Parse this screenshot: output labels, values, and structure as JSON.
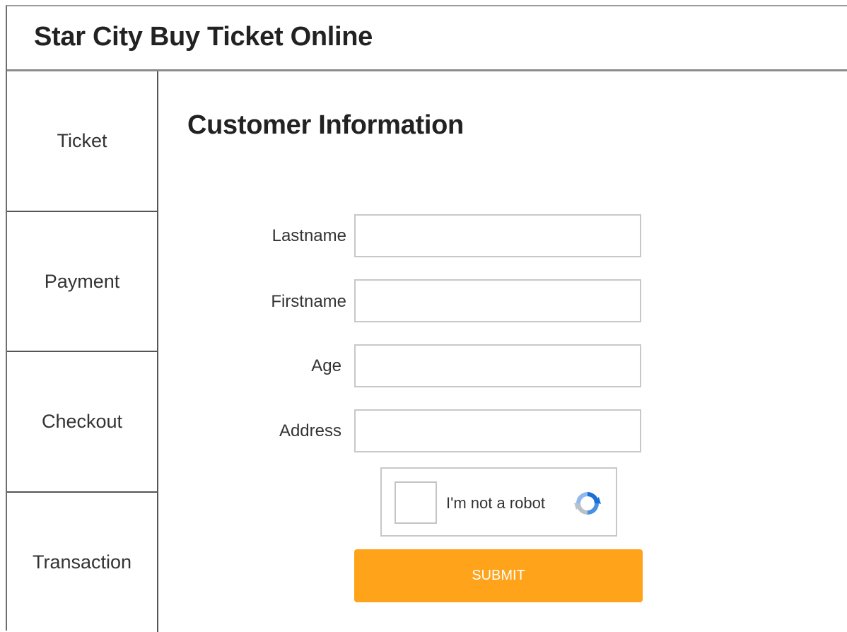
{
  "header": {
    "title": "Star City Buy Ticket Online"
  },
  "sidebar": {
    "items": [
      {
        "label": "Ticket"
      },
      {
        "label": "Payment"
      },
      {
        "label": "Checkout"
      },
      {
        "label": "Transaction"
      }
    ]
  },
  "main": {
    "title": "Customer Information",
    "form": {
      "fields": [
        {
          "label": "Lastname",
          "value": ""
        },
        {
          "label": "Firstname",
          "value": ""
        },
        {
          "label": "Age",
          "value": ""
        },
        {
          "label": "Address",
          "value": ""
        }
      ],
      "captcha": {
        "label": "I'm not a robot",
        "icon": "recaptcha-icon",
        "checked": false
      },
      "submit_label": "SUBMIT"
    }
  },
  "colors": {
    "submit_bg": "#ffa31a",
    "border": "#c8c8c8",
    "divider": "#555555"
  }
}
